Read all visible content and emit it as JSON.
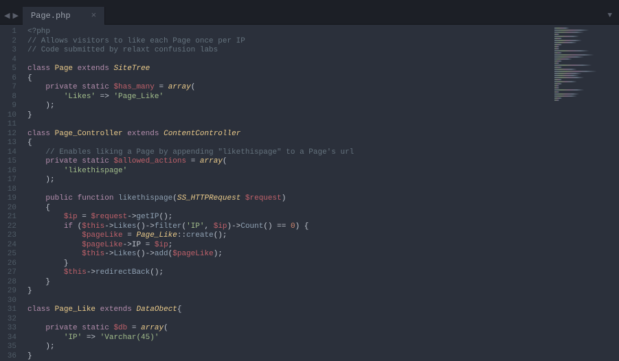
{
  "tab": {
    "filename": "Page.php",
    "close_glyph": "×"
  },
  "nav": {
    "left": "◀",
    "right": "▶",
    "dropdown": "▼"
  },
  "lines": {
    "count": 36
  },
  "code": {
    "l1_open": "<?php",
    "l2_comment": "// Allows visitors to like each Page once per IP",
    "l3_comment": "// Code submitted by relaxt confusion labs",
    "l5_class": "class",
    "l5_name": "Page",
    "l5_extends": "extends",
    "l5_parent": "SiteTree",
    "brace_open": "{",
    "brace_close": "}",
    "l7_priv": "private",
    "l7_static": "static",
    "l7_var": "$has_many",
    "l7_eq": "=",
    "l7_array": "array",
    "paren_open": "(",
    "paren_close": ");",
    "paren_close_plain": ")",
    "l8_key": "'Likes'",
    "l8_arrow": "=>",
    "l8_val": "'Page_Like'",
    "l12_name": "Page_Controller",
    "l12_parent": "ContentController",
    "l14_comment": "// Enables liking a Page by appending \"likethispage\" to a Page's url",
    "l15_var": "$allowed_actions",
    "l16_val": "'likethispage'",
    "l19_public": "public",
    "l19_function": "function",
    "l19_name": "likethispage",
    "l19_ptype": "SS_HTTPRequest",
    "l19_pvar": "$request",
    "l21_var": "$ip",
    "l21_req": "$request",
    "l21_arrow": "->",
    "l21_getip": "getIP",
    "l21_call": "();",
    "l22_if": "if",
    "l22_this": "$this",
    "l22_likes": "Likes",
    "l22_filter": "filter",
    "l22_ipstr": "'IP'",
    "l22_comma": ",",
    "l22_ipvar": "$ip",
    "l22_count": "Count",
    "l22_eqeq": "==",
    "l22_zero": "0",
    "l23_var": "$pageLike",
    "l23_pl": "Page_Like",
    "l23_scope": "::",
    "l23_create": "create",
    "l24_ip": "IP",
    "l25_add": "add",
    "l27_redirect": "redirectBack",
    "l31_name": "Page_Like",
    "l31_parent": "DataObect",
    "l33_var": "$db",
    "l34_key": "'IP'",
    "l34_val": "'Varchar(45)'",
    "semi": ";"
  }
}
